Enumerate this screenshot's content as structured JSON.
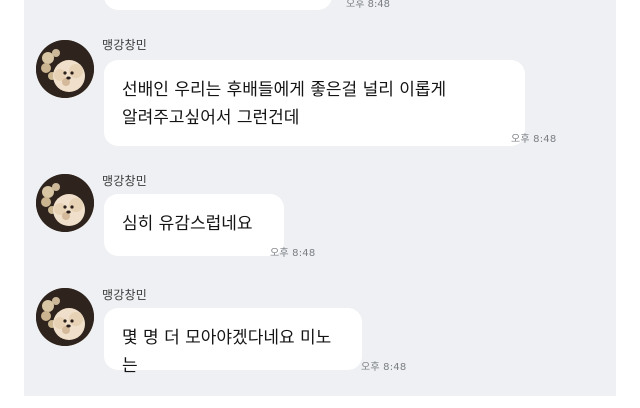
{
  "chat": {
    "top_time": "오후 8:48",
    "messages": [
      {
        "sender": "맹강창민",
        "text": "선배인 우리는 후배들에게 좋은걸 널리 이롭게\n알려주고싶어서 그런건데",
        "time": "오후 8:48"
      },
      {
        "sender": "맹강창민",
        "text": "심히 유감스럽네요",
        "time": "오후 8:48"
      },
      {
        "sender": "맹강창민",
        "text": "몇 명 더 모아야겠다네요 미노는",
        "time": "오후 8:48"
      }
    ]
  }
}
